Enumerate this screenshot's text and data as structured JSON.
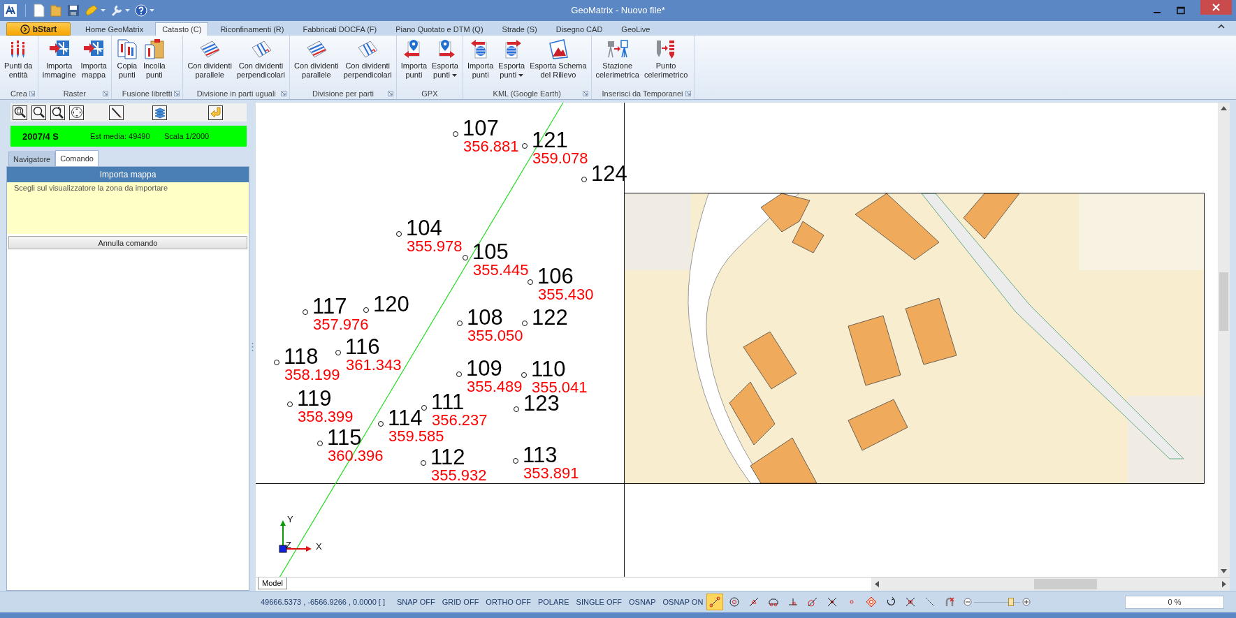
{
  "window": {
    "title": "GeoMatrix - Nuovo file*"
  },
  "ribbon_tabs": [
    {
      "label": "bStart",
      "kind": "start",
      "selected": false
    },
    {
      "label": "Home GeoMatrix",
      "kind": "tab",
      "selected": false
    },
    {
      "label": "Catasto (C)",
      "kind": "tab",
      "selected": true
    },
    {
      "label": "Riconfinamenti (R)",
      "kind": "tab",
      "selected": false
    },
    {
      "label": "Fabbricati DOCFA (F)",
      "kind": "tab",
      "selected": false
    },
    {
      "label": "Piano Quotato e DTM (Q)",
      "kind": "tab",
      "selected": false
    },
    {
      "label": "Strade (S)",
      "kind": "tab",
      "selected": false
    },
    {
      "label": "Disegno CAD",
      "kind": "tab",
      "selected": false
    },
    {
      "label": "GeoLive",
      "kind": "tab",
      "selected": false
    }
  ],
  "ribbon_groups": [
    {
      "name": "Crea",
      "launcher": true,
      "buttons": [
        {
          "lines": [
            "Punti da",
            "entità"
          ],
          "dropdown": false
        }
      ]
    },
    {
      "name": "Raster",
      "launcher": true,
      "buttons": [
        {
          "lines": [
            "Importa",
            "immagine"
          ],
          "dropdown": false
        },
        {
          "lines": [
            "Importa",
            "mappa"
          ],
          "dropdown": false
        }
      ]
    },
    {
      "name": "Fusione libretti",
      "launcher": true,
      "buttons": [
        {
          "lines": [
            "Copia",
            "punti"
          ],
          "dropdown": false
        },
        {
          "lines": [
            "Incolla",
            "punti"
          ],
          "dropdown": false
        }
      ]
    },
    {
      "name": "Divisione in parti uguali",
      "launcher": true,
      "buttons": [
        {
          "lines": [
            "Con dividenti",
            "parallele"
          ],
          "dropdown": false
        },
        {
          "lines": [
            "Con dividenti",
            "perpendicolari"
          ],
          "dropdown": false
        }
      ]
    },
    {
      "name": "Divisione per parti",
      "launcher": true,
      "buttons": [
        {
          "lines": [
            "Con dividenti",
            "parallele"
          ],
          "dropdown": false
        },
        {
          "lines": [
            "Con dividenti",
            "perpendicolari"
          ],
          "dropdown": false
        }
      ]
    },
    {
      "name": "GPX",
      "launcher": false,
      "buttons": [
        {
          "lines": [
            "Importa",
            "punti"
          ],
          "dropdown": false
        },
        {
          "lines": [
            "Esporta",
            "punti"
          ],
          "dropdown": true
        }
      ]
    },
    {
      "name": "KML (Google Earth)",
      "launcher": true,
      "buttons": [
        {
          "lines": [
            "Importa",
            "punti"
          ],
          "dropdown": false
        },
        {
          "lines": [
            "Esporta",
            "punti"
          ],
          "dropdown": true
        },
        {
          "lines": [
            "Esporta Schema",
            "del Rilievo"
          ],
          "dropdown": false
        }
      ]
    },
    {
      "name": "Inserisci da Temporanei",
      "launcher": true,
      "buttons": [
        {
          "lines": [
            "Stazione",
            "celerimetrica"
          ],
          "dropdown": false
        },
        {
          "lines": [
            "Punto",
            "celerimetrico"
          ],
          "dropdown": false
        }
      ]
    }
  ],
  "left_panel": {
    "info_bar": {
      "sheet": "2007/4 S",
      "mean_east": "Est media: 49490",
      "scale": "Scala 1/2000"
    },
    "tabs": [
      {
        "label": "Navigatore",
        "selected": false
      },
      {
        "label": "Comando",
        "selected": true
      }
    ],
    "command": {
      "title": "Importa mappa",
      "prompt": "Scegli sul visualizzatore la zona da importare",
      "cancel_button": "Annulla comando"
    }
  },
  "canvas": {
    "points": [
      {
        "number": "107",
        "elevation": "356.881"
      },
      {
        "number": "121",
        "elevation": "359.078"
      },
      {
        "number": "124"
      },
      {
        "number": "104",
        "elevation": "355.978"
      },
      {
        "number": "105",
        "elevation": "355.445"
      },
      {
        "number": "106",
        "elevation": "355.430"
      },
      {
        "number": "117",
        "elevation": "357.976"
      },
      {
        "number": "120"
      },
      {
        "number": "118",
        "elevation": "358.199"
      },
      {
        "number": "116",
        "elevation": "361.343"
      },
      {
        "number": "108",
        "elevation": "355.050"
      },
      {
        "number": "122"
      },
      {
        "number": "109",
        "elevation": "355.489"
      },
      {
        "number": "110",
        "elevation": "355.041"
      },
      {
        "number": "119",
        "elevation": "358.399"
      },
      {
        "number": "111",
        "elevation": "356.237"
      },
      {
        "number": "123"
      },
      {
        "number": "115",
        "elevation": "360.396"
      },
      {
        "number": "114",
        "elevation": "359.585"
      },
      {
        "number": "112",
        "elevation": "355.932"
      },
      {
        "number": "113",
        "elevation": "353.891"
      }
    ],
    "axes": {
      "y": "Y",
      "z": "Z",
      "x": "X"
    },
    "layout_tab": "Model"
  },
  "status_bar": {
    "coordinates": "49666.5373 , -6566.9266 , 0.0000 [ ]",
    "toggles": [
      "SNAP OFF",
      "GRID OFF",
      "ORTHO OFF",
      "POLARE",
      "SINGLE OFF",
      "OSNAP",
      "OSNAP ON"
    ],
    "osnaps": [
      {
        "kind": "endpoint",
        "selected": true
      },
      {
        "kind": "center",
        "selected": false
      },
      {
        "kind": "midpoint",
        "selected": false
      },
      {
        "kind": "car",
        "selected": false
      },
      {
        "kind": "perpendicular",
        "selected": false
      },
      {
        "kind": "tangent",
        "selected": false
      },
      {
        "kind": "intersection",
        "selected": false
      },
      {
        "kind": "node",
        "selected": false
      },
      {
        "kind": "quadrant",
        "selected": false
      },
      {
        "kind": "rotate",
        "selected": false
      },
      {
        "kind": "apparent",
        "selected": false
      },
      {
        "kind": "extension",
        "selected": false
      },
      {
        "kind": "clear",
        "selected": false
      }
    ],
    "zoom": {
      "level": 0.8
    },
    "progress": {
      "level": 0,
      "text": "0 %"
    }
  }
}
